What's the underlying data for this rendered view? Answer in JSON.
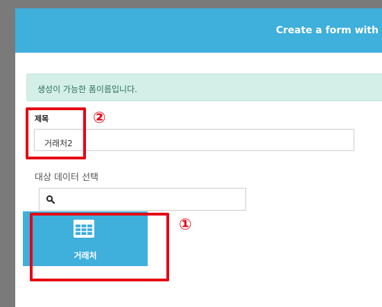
{
  "header": {
    "title": "Create a form with ex"
  },
  "alert": {
    "message": "생성이 가능한 폼이름입니다."
  },
  "form": {
    "title_label": "제목",
    "title_value": "거래처2",
    "target_label": "대상 데이터 선택",
    "search_value": "",
    "search_placeholder": ""
  },
  "tiles": [
    {
      "label": "거래처",
      "icon": "table-grid-icon"
    }
  ],
  "annotations": {
    "callout_1": "①",
    "callout_2": "②"
  },
  "colors": {
    "header_bg": "#3fafdc",
    "alert_bg": "#d3efe7",
    "tile_bg": "#3fafdc",
    "annotation_red": "#e60012",
    "backdrop": "#7a7a7a"
  }
}
